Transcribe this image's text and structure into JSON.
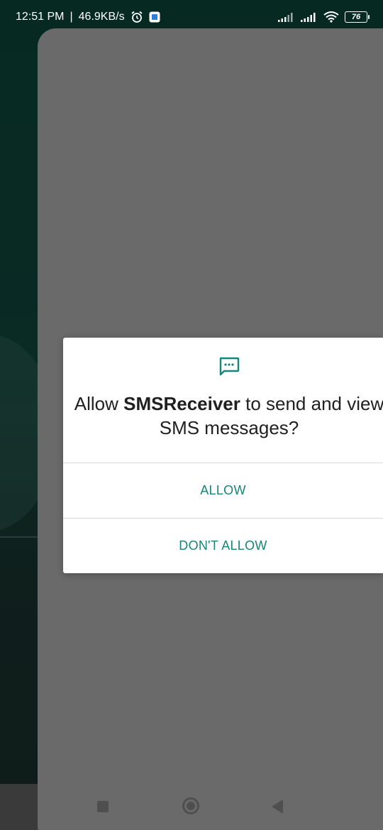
{
  "status_bar": {
    "time": "12:51 PM",
    "separator": "|",
    "network_speed": "46.9KB/s",
    "battery_level": "76",
    "icons": [
      "alarm-icon",
      "notification-app-icon",
      "signal-icon",
      "signal-icon",
      "wifi-icon",
      "battery-icon"
    ]
  },
  "dialog": {
    "message_prefix": "Allow ",
    "app_name": "SMSReceiver",
    "message_suffix": " to send and view SMS messages?",
    "icon": "sms-message-icon",
    "allow_label": "ALLOW",
    "deny_label": "DON'T ALLOW",
    "accent_color": "#16857a"
  },
  "navigation_bar": {
    "buttons": [
      "recents-button",
      "home-button",
      "back-button"
    ]
  }
}
